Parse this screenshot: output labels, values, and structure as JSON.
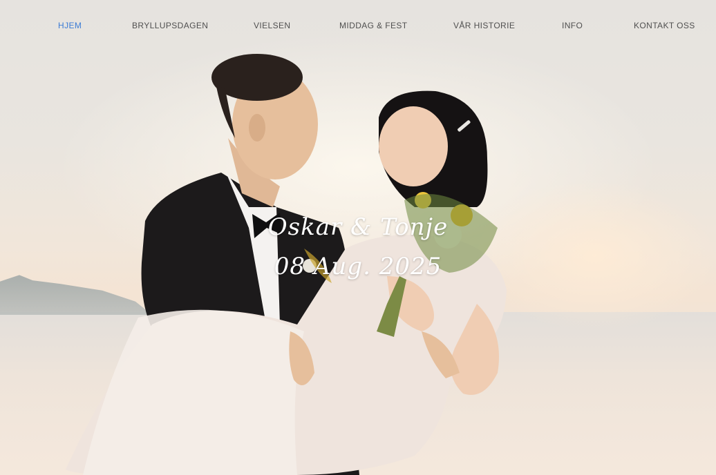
{
  "nav": {
    "items": [
      {
        "label": "HJEM",
        "active": true
      },
      {
        "label": "BRYLLUPSDAGEN",
        "active": false
      },
      {
        "label": "VIELSEN",
        "active": false
      },
      {
        "label": "MIDDAG & FEST",
        "active": false
      },
      {
        "label": "VÅR HISTORIE",
        "active": false
      },
      {
        "label": "INFO",
        "active": false
      },
      {
        "label": "KONTAKT OSS",
        "active": false
      }
    ],
    "active_color": "#3a7bd5",
    "text_color": "#4f4f4f"
  },
  "hero": {
    "names": "Oskar & Tonje",
    "date": "08 Aug. 2025",
    "image": "wedding-couple-photo"
  }
}
